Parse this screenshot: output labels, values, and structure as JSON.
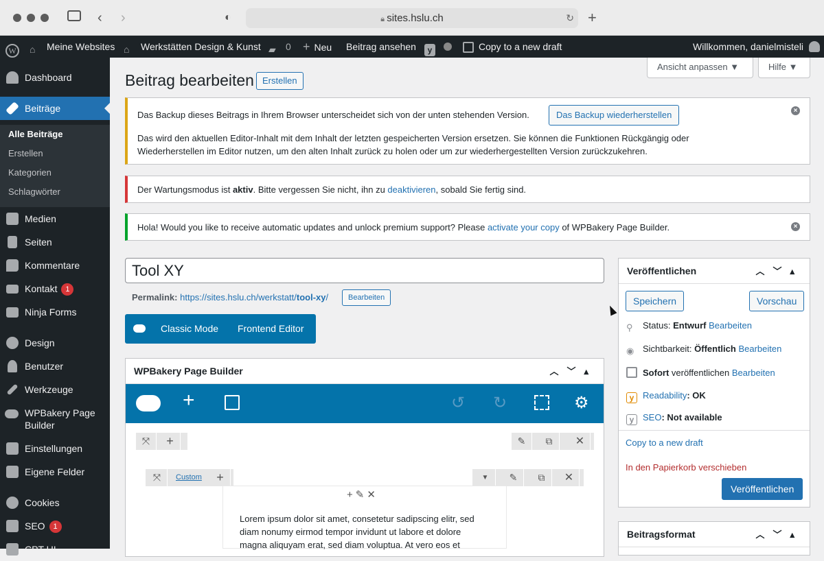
{
  "browser": {
    "url": "sites.hslu.ch"
  },
  "adminbar": {
    "my_sites": "Meine Websites",
    "site_name": "Werkstätten Design & Kunst",
    "comments_count": "0",
    "new_label": "Neu",
    "view_post": "Beitrag ansehen",
    "copy_draft": "Copy to a new draft",
    "welcome": "Willkommen, danielmisteli"
  },
  "sidebar": {
    "dashboard": "Dashboard",
    "posts": "Beiträge",
    "sub": [
      "Alle Beiträge",
      "Erstellen",
      "Kategorien",
      "Schlagwörter"
    ],
    "media": "Medien",
    "pages": "Seiten",
    "comments": "Kommentare",
    "contact": "Kontakt",
    "contact_badge": "1",
    "ninja": "Ninja Forms",
    "design": "Design",
    "users": "Benutzer",
    "tools": "Werkzeuge",
    "wpbakery_1": "WPBakery Page",
    "wpbakery_2": "Builder",
    "settings": "Einstellungen",
    "fields": "Eigene Felder",
    "cookies": "Cookies",
    "seo": "SEO",
    "seo_badge": "1",
    "cpt": "CPT UI"
  },
  "header": {
    "screen_options": "Ansicht anpassen ▼",
    "help": "Hilfe ▼",
    "title": "Beitrag bearbeiten",
    "create_button": "Erstellen"
  },
  "notices": {
    "backup_text": "Das Backup dieses Beitrags in Ihrem Browser unterscheidet sich von der unten stehenden Version.",
    "backup_button": "Das Backup wiederherstellen",
    "backup_detail_1": "Das wird den aktuellen Editor-Inhalt mit dem Inhalt der letzten gespeicherten Version ersetzen. Sie können die Funktionen Rückgängig oder",
    "backup_detail_2": "Wiederherstellen im Editor nutzen, um den alten Inhalt zurück zu holen oder um zur wiederhergestellten Version zurückzukehren.",
    "maint_pre": "Der Wartungsmodus ist ",
    "maint_bold": "aktiv",
    "maint_mid": ". Bitte vergessen Sie nicht, ihn zu ",
    "maint_link": "deaktivieren",
    "maint_post": ", sobald Sie fertig sind.",
    "wpb_pre": "Hola! Would you like to receive automatic updates and unlock premium support? Please ",
    "wpb_link": "activate your copy",
    "wpb_post": " of WPBakery Page Builder."
  },
  "editor": {
    "title_value": "Tool XY",
    "permalink_label": "Permalink:",
    "permalink_base": "https://sites.hslu.ch/werkstatt/",
    "permalink_slug": "tool-xy",
    "permalink_end": "/",
    "permalink_edit": "Bearbeiten",
    "classic_mode": "Classic Mode",
    "frontend_editor": "Frontend Editor",
    "wpb_title": "WPBakery Page Builder",
    "custom_label": "Custom",
    "lorem_1": "Lorem ipsum dolor sit amet, consetetur sadipscing elitr, sed",
    "lorem_2": "diam nonumy eirmod tempor invidunt ut labore et dolore",
    "lorem_3": "magna aliquyam erat, sed diam voluptua. At vero eos et"
  },
  "publish": {
    "title": "Veröffentlichen",
    "save": "Speichern",
    "preview": "Vorschau",
    "status_label": "Status: ",
    "status_value": "Entwurf",
    "visibility_label": "Sichtbarkeit: ",
    "visibility_value": "Öffentlich",
    "immediately": "Sofort",
    "publish_text": " veröffentlichen",
    "edit": "Bearbeiten",
    "readability_link": "Readability",
    "readability_value": ": OK",
    "seo_link": "SEO",
    "seo_value": ": Not available",
    "copy_draft": "Copy to a new draft",
    "trash": "In den Papierkorb verschieben",
    "publish_button": "Veröffentlichen"
  },
  "format": {
    "title": "Beitragsformat"
  },
  "colors": {
    "accent": "#2271b1",
    "wpbakery": "#0473aa",
    "sidebar": "#1d2327"
  }
}
